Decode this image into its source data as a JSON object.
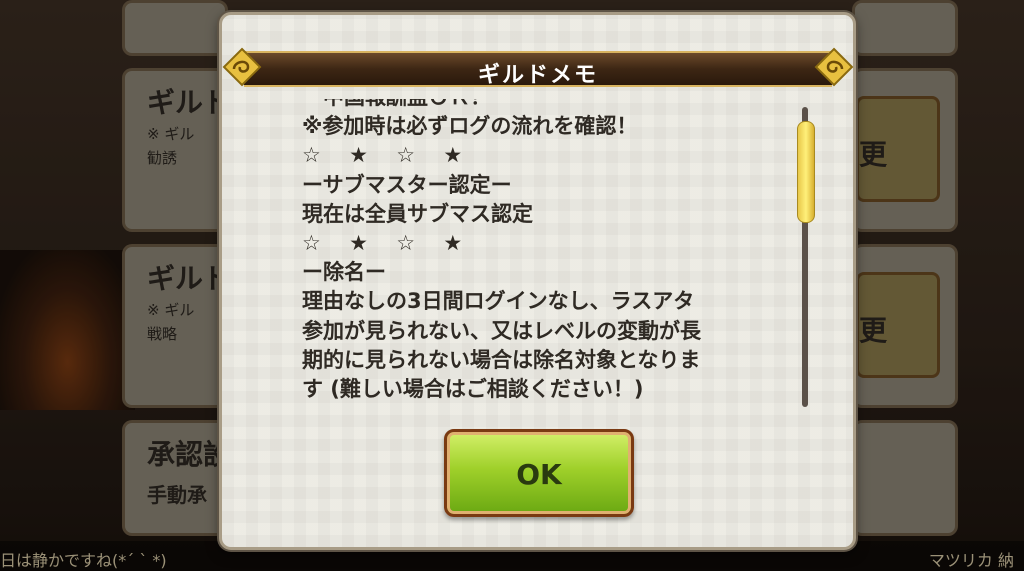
{
  "background": {
    "cards": [
      {
        "title": "ギルド",
        "sub": "※ ギル",
        "sub2": "勧誘"
      },
      {
        "title": "ギルド",
        "sub": "※ ギル",
        "sub2": "戦略"
      },
      {
        "title": "承認設",
        "sub": "手動承",
        "sub2": ""
      }
    ],
    "side_buttons": [
      "更",
      "更",
      ""
    ],
    "chat_left": "日は静かですね(*´ ` *)",
    "chat_right": "マツリカ 納"
  },
  "modal": {
    "title": "ギルドメモ",
    "memo_lines": [
      "ー中国報酬盆ＯＫ！",
      "※参加時は必ずログの流れを確認！",
      "☆　 ★　 ☆　 ★",
      "ーサブマスター認定ー",
      "現在は全員サブマス認定",
      "☆　 ★　 ☆　 ★",
      "ー除名ー",
      "理由なしの3日間ログインなし、ラスアタ",
      "参加が見られない、又はレベルの変動が長",
      "期的に見られない場合は除名対象となりま",
      "す (難しい場合はご相談ください！)"
    ],
    "ok_label": "OK"
  },
  "colors": {
    "title_bar": "#3d2614",
    "modal_bg": "#ecebe3",
    "ok_green": "#9fd02a",
    "scroll_thumb": "#f0d84a"
  }
}
